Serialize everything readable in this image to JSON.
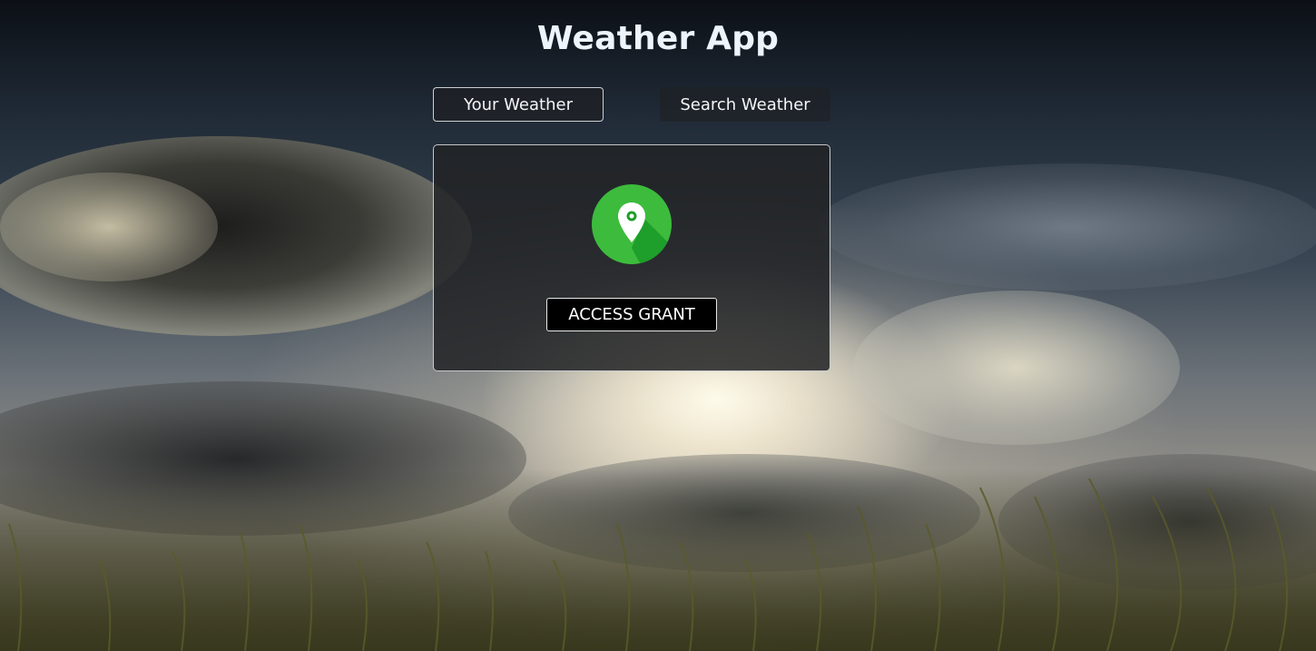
{
  "app": {
    "title": "Weather App"
  },
  "tabs": [
    {
      "label": "Your Weather",
      "active": true
    },
    {
      "label": "Search Weather",
      "active": false
    }
  ],
  "grant_location": {
    "icon": "location-pin-icon",
    "icon_color": "#3dbb3d",
    "button_label": "ACCESS GRANT"
  },
  "background": {
    "icon": "sky-with-clouds-and-grass"
  }
}
